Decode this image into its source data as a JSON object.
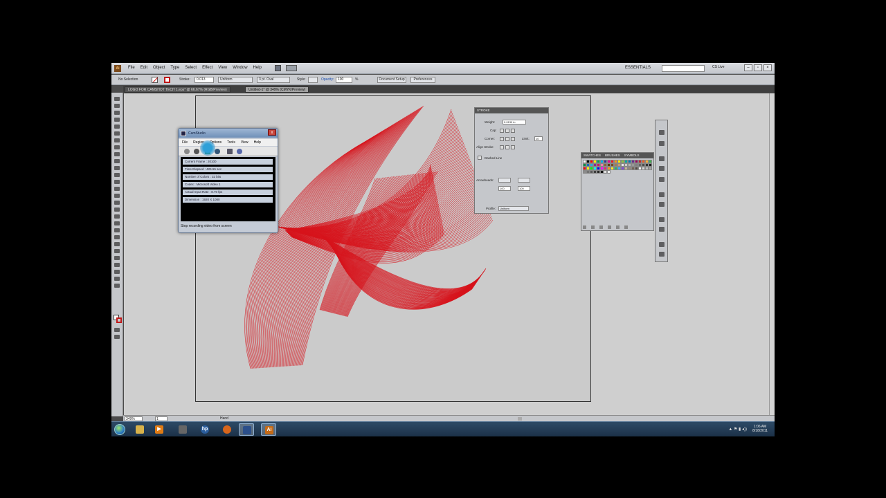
{
  "app": {
    "logo": "Ai",
    "menu": [
      "File",
      "Edit",
      "Object",
      "Type",
      "Select",
      "Effect",
      "View",
      "Window",
      "Help"
    ],
    "workspace": "ESSENTIALS",
    "cs_live": "CS Live"
  },
  "control_bar": {
    "selection": "No Selection",
    "stroke_label": "Stroke:",
    "stroke_value": "0.013",
    "profile": "Uniform",
    "brush": "3 pt. Oval",
    "style_label": "Style:",
    "opacity_label": "Opacity:",
    "opacity_value": "100",
    "pct": "%",
    "document_setup": "Document Setup",
    "preferences": "Preferences"
  },
  "tabs": [
    {
      "label": "LOGO FOR CAMSHOT TECH 1.eps* @ 66.67% (RGB/Preview)"
    },
    {
      "label": "Untitled-1* @ 349% (CMYK/Preview)"
    }
  ],
  "camstudio": {
    "title": "CamStudio",
    "close": "x",
    "menu": [
      "File",
      "Region",
      "Options",
      "Tools",
      "View",
      "Help"
    ],
    "rows": [
      "Current Frame : 20100",
      "Time Elapsed : 425.55 sec",
      "Number of Colors : 32 bits",
      "Codec : Microsoft Video 1",
      "Actual Input Rate : 8.70 fps",
      "Dimension : 1920 X 1080"
    ],
    "status": "Stop recording video from screen"
  },
  "stroke_panel": {
    "title": "STROKE",
    "weight_label": "Weight:",
    "weight_value": "0.0139 in",
    "cap_label": "Cap:",
    "corner_label": "Corner:",
    "limit_label": "Limit:",
    "limit_value": "10",
    "align_label": "Align Stroke:",
    "dashed_label": "Dashed Line",
    "arrowheads_label": "Arrowheads:",
    "scale_value_1": "100",
    "scale_value_2": "100",
    "profile_label": "Profile:",
    "profile_value": "Uniform"
  },
  "swatches_panel": {
    "tabs": [
      "SWATCHES",
      "BRUSHES",
      "SYMBOLS"
    ],
    "colors": [
      "#ffffff",
      "#000000",
      "#ff0000",
      "#ffff00",
      "#00a651",
      "#00aeef",
      "#2e3192",
      "#ec008c",
      "#ed1c24",
      "#f7941d",
      "#fff200",
      "#8dc63f",
      "#00a99d",
      "#0072bc",
      "#662d91",
      "#9e005d",
      "#c1272d",
      "#f15a24",
      "#fbb03b",
      "#39b54a",
      "#009245",
      "#0071bc",
      "#29abe2",
      "#93278f",
      "#d4145a",
      "#ff7bac",
      "#8c6239",
      "#603813",
      "#754c24",
      "#a67c52",
      "#c69c6d",
      "#e6e6e6",
      "#cccccc",
      "#b3b3b3",
      "#999999",
      "#808080",
      "#666666",
      "#4d4d4d",
      "#333333",
      "#1a1a1a",
      "#ff0000",
      "#ffff00",
      "#00ff00",
      "#00ffff",
      "#0000ff",
      "#ff00ff",
      "#ed1e79",
      "#f7931e",
      "#fcee21",
      "#22b573",
      "#3fa9f5",
      "#7f47dd",
      "#c7b299",
      "#998675",
      "#736357",
      "#534741",
      "#f2f2f2",
      "#d9d9d9",
      "#bfbfbf",
      "#a6a6a6",
      "#8c8c8c",
      "#737373",
      "#595959",
      "#404040",
      "#262626",
      "#0d0d0d",
      "#e0e0e0",
      "#f0f0f0"
    ]
  },
  "status_bar": {
    "zoom": "349%",
    "page": "1",
    "selection_tool": "Hand"
  },
  "taskbar": {
    "time": "1:06 AM",
    "date": "8/18/2011"
  },
  "colors": {
    "artwork": "#d7141c",
    "accent": "#c01818"
  }
}
